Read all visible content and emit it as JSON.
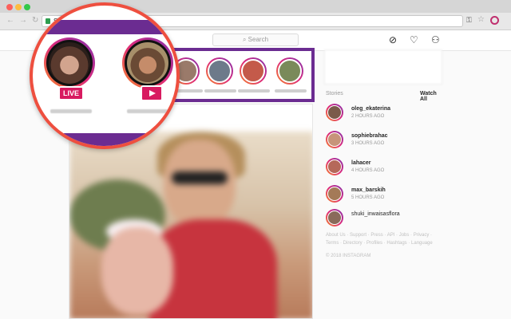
{
  "browser": {
    "url_fragment": "S",
    "icons": [
      "back-icon",
      "forward-icon",
      "refresh-icon",
      "lock-icon",
      "key-icon",
      "star-icon",
      "extension-icon"
    ]
  },
  "header": {
    "search_placeholder": "Search",
    "icons": [
      "compass-icon",
      "heart-icon",
      "profile-icon"
    ]
  },
  "magnified_stories": [
    {
      "badge": "LIVE",
      "type": "live"
    },
    {
      "badge": "",
      "type": "video"
    }
  ],
  "sidebar": {
    "stories_heading": "Stories",
    "watch_all": "Watch All",
    "stories": [
      {
        "name": "oleg_ekaterina",
        "time": "2 HOURS AGO"
      },
      {
        "name": "sophiebrahac",
        "time": "3 HOURS AGO"
      },
      {
        "name": "lahacer",
        "time": "4 HOURS AGO"
      },
      {
        "name": "max_barskih",
        "time": "5 HOURS AGO"
      },
      {
        "name": "shuki_inwaisasflora",
        "time": ""
      }
    ],
    "links": "About Us · Support · Press · API · Jobs · Privacy · Terms · Directory · Profiles · Hashtags · Language",
    "copyright": "© 2018 INSTAGRAM"
  },
  "colors": {
    "accent_purple": "#6b2c91",
    "magnifier_border": "#ee4f3f",
    "badge_pink": "#d81b60"
  }
}
